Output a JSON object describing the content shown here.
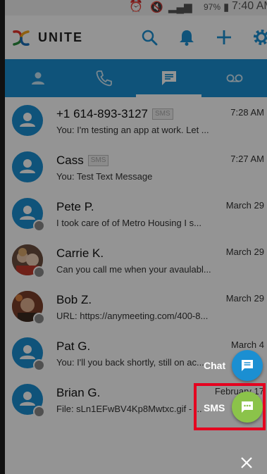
{
  "status_bar": {
    "battery": "97%",
    "time": "7:40 AM"
  },
  "header": {
    "app_name": "UNITE",
    "icons": [
      "search-icon",
      "bell-icon",
      "plus-icon",
      "settings-icon"
    ]
  },
  "tabs": [
    {
      "name": "contacts",
      "icon": "person-icon"
    },
    {
      "name": "calls",
      "icon": "phone-icon"
    },
    {
      "name": "messages",
      "icon": "message-icon",
      "selected": true
    },
    {
      "name": "voicemail",
      "icon": "voicemail-icon"
    }
  ],
  "conversations": [
    {
      "name": "+1 614-893-3127",
      "badge": "SMS",
      "preview": "You: I'm testing an app at work.  Let ...",
      "time": "7:28 AM"
    },
    {
      "name": "Cass",
      "badge": "SMS",
      "preview": "You: Test Text Message",
      "time": "7:27 AM"
    },
    {
      "name": "Pete P.",
      "badge": "",
      "preview": "I took care of  of Metro Housing  I s...",
      "time": "March 29"
    },
    {
      "name": "Carrie K.",
      "badge": "",
      "preview": "Can you call me when your avaulabl...",
      "time": "March 29"
    },
    {
      "name": "Bob Z.",
      "badge": "",
      "preview": "URL: https://anymeeting.com/400-8...",
      "time": "March 29"
    },
    {
      "name": "Pat G.",
      "badge": "",
      "preview": "You: I'll you back shortly, still on  ac...",
      "time": "March 4"
    },
    {
      "name": "Brian G.",
      "badge": "",
      "preview": "File: sLn1EFwBV4Kp8Mwtxc.gif - ...",
      "time": "February 17"
    }
  ],
  "fab_menu": {
    "chat_label": "Chat",
    "sms_label": "SMS"
  },
  "colors": {
    "accent": "#1b8fd2",
    "sms_fab": "#8bc34a",
    "highlight": "#e5001f"
  }
}
